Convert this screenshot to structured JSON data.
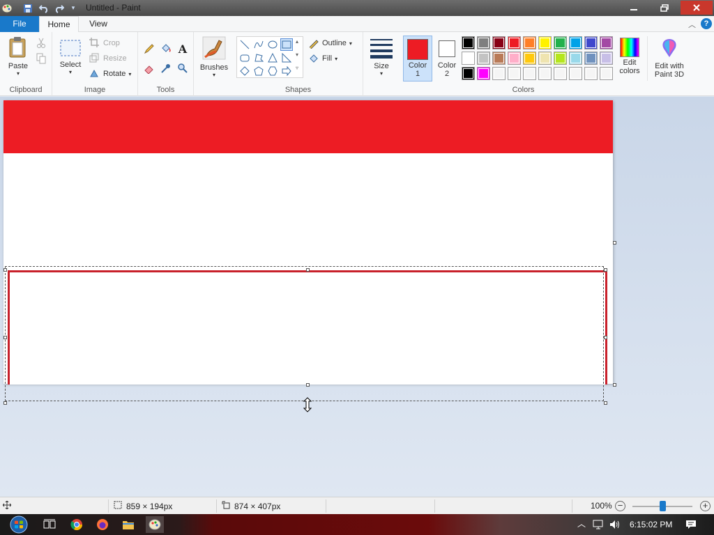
{
  "window": {
    "title": "Untitled - Paint"
  },
  "tabs": {
    "file": "File",
    "home": "Home",
    "view": "View",
    "help": "?"
  },
  "clipboard": {
    "paste": "Paste",
    "label": "Clipboard"
  },
  "image": {
    "select": "Select",
    "crop": "Crop",
    "resize": "Resize",
    "rotate": "Rotate",
    "label": "Image"
  },
  "tools": {
    "label": "Tools"
  },
  "brushes": {
    "label": "Brushes"
  },
  "shapes": {
    "outline": "Outline",
    "fill": "Fill",
    "label": "Shapes"
  },
  "size": {
    "label": "Size"
  },
  "colors": {
    "color1_label": "Color",
    "color1_num": "1",
    "color2_label": "Color",
    "color2_num": "2",
    "edit_colors_1": "Edit",
    "edit_colors_2": "colors",
    "paint3d_1": "Edit with",
    "paint3d_2": "Paint 3D",
    "label": "Colors",
    "color1": "#ed1c24",
    "color2": "#ffffff",
    "palette_row1": [
      "#000000",
      "#7f7f7f",
      "#880015",
      "#ed1c24",
      "#ff7f27",
      "#fff200",
      "#22b14c",
      "#00a2e8",
      "#3f48cc",
      "#a349a4"
    ],
    "palette_row2": [
      "#ffffff",
      "#c3c3c3",
      "#b97a57",
      "#ffaec9",
      "#ffc90e",
      "#efe4b0",
      "#b5e61d",
      "#99d9ea",
      "#7092be",
      "#c8bfe7"
    ],
    "palette_row3": [
      "#000000",
      "#ff00ff",
      "#f5f5f5",
      "#f5f5f5",
      "#f5f5f5",
      "#f5f5f5",
      "#f5f5f5",
      "#f5f5f5",
      "#f5f5f5",
      "#f5f5f5"
    ]
  },
  "canvas": {
    "band_color": "#ed1c24",
    "box_color": "#c8202a"
  },
  "status": {
    "selection_size": "859 × 194px",
    "image_size": "874 × 407px",
    "zoom": "100%"
  },
  "taskbar": {
    "time": "6:15:02 PM"
  }
}
